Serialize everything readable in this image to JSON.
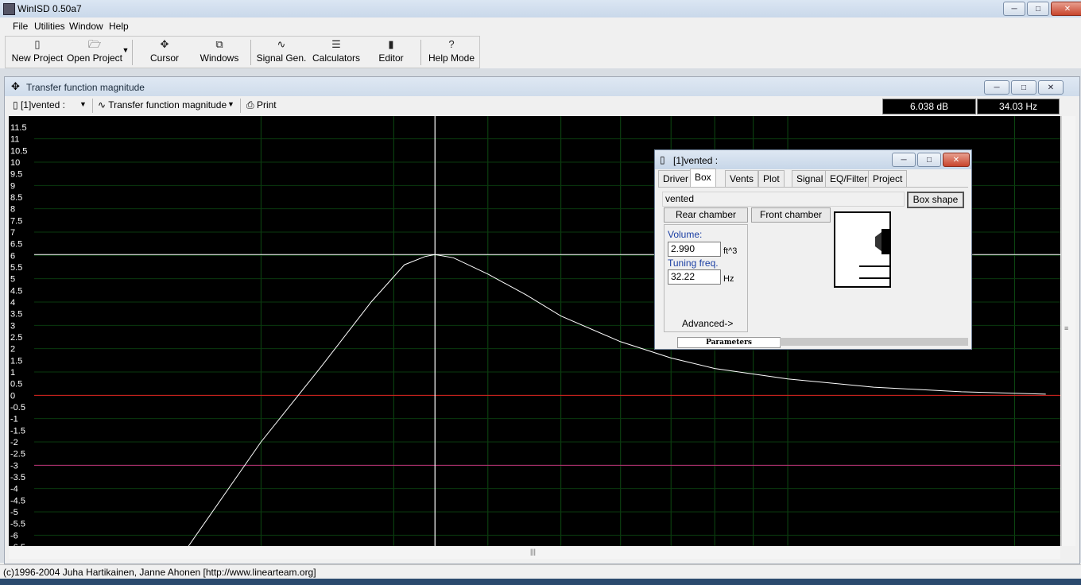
{
  "app": {
    "title": "WinISD 0.50a7"
  },
  "menu": [
    "File",
    "Utilities",
    "Window",
    "Help"
  ],
  "toolbar": {
    "buttons": [
      {
        "label": "New Project",
        "icon": "new-project-icon"
      },
      {
        "label": "Open Project",
        "icon": "open-project-icon"
      },
      {
        "label": "Cursor",
        "icon": "cursor-icon"
      },
      {
        "label": "Windows",
        "icon": "windows-icon"
      },
      {
        "label": "Signal Gen.",
        "icon": "signal-gen-icon"
      },
      {
        "label": "Calculators",
        "icon": "calculators-icon"
      },
      {
        "label": "Editor",
        "icon": "editor-icon"
      },
      {
        "label": "Help Mode",
        "icon": "help-icon"
      }
    ]
  },
  "graph_window": {
    "title": "Transfer function magnitude",
    "project_select": "[1]vented :",
    "graph_select": "Transfer function magnitude",
    "print_label": "Print",
    "readout_db": "6.038 dB",
    "readout_hz": "34.03 Hz"
  },
  "chart_data": {
    "type": "line",
    "ylim": [
      -6.5,
      11.5
    ],
    "y_ticks": [
      "11.5",
      "11",
      "10.5",
      "10",
      "9.5",
      "9",
      "8.5",
      "8",
      "7.5",
      "7",
      "6.5",
      "6",
      "5.5",
      "5",
      "4.5",
      "4",
      "3.5",
      "3",
      "2.5",
      "2",
      "1.5",
      "1",
      "0.5",
      "0",
      "-0.5",
      "-1",
      "-1.5",
      "-2",
      "-2.5",
      "-3",
      "-3.5",
      "-4",
      "-4.5",
      "-5",
      "-5.5",
      "-6",
      "-6.5"
    ],
    "grid": true,
    "cursor": {
      "x_hz": 34.03,
      "y_db": 6.038
    },
    "reference_lines": [
      {
        "y": 6.038,
        "color": "#ffffff"
      },
      {
        "y": 0,
        "color": "#e02020"
      },
      {
        "y": -3,
        "color": "#c0307a"
      }
    ],
    "series": [
      {
        "color": "#ffffff",
        "x_hz": [
          16,
          20,
          24,
          28,
          31,
          33,
          34.03,
          36,
          40,
          45,
          50,
          60,
          70,
          80,
          100,
          130,
          170,
          220
        ],
        "y_db": [
          -6.5,
          -2.0,
          1.2,
          4.0,
          5.6,
          5.95,
          6.038,
          5.9,
          5.2,
          4.3,
          3.4,
          2.3,
          1.6,
          1.15,
          0.7,
          0.35,
          0.15,
          0.05
        ]
      }
    ],
    "log_x": true,
    "x_range_hz": [
      10,
      230
    ]
  },
  "dialog": {
    "title": "[1]vented :",
    "tabs": [
      "Driver",
      "Box",
      "Vents",
      "Plot",
      "Signal",
      "EQ/Filter",
      "Project"
    ],
    "active_tab": "Box",
    "name_value": "vented",
    "box_shape_button": "Box shape",
    "rear_chamber_button": "Rear chamber",
    "front_chamber_button": "Front chamber",
    "volume_label": "Volume:",
    "volume_value": "2.990",
    "volume_unit": "ft^3",
    "tuning_label": "Tuning freq.",
    "tuning_value": "32.22",
    "tuning_unit": "Hz",
    "advanced_label": "Advanced->",
    "footer_tab": "Parameters"
  },
  "status": {
    "text": "(c)1996-2004 Juha Hartikainen, Janne Ahonen [http://www.linearteam.org]"
  }
}
